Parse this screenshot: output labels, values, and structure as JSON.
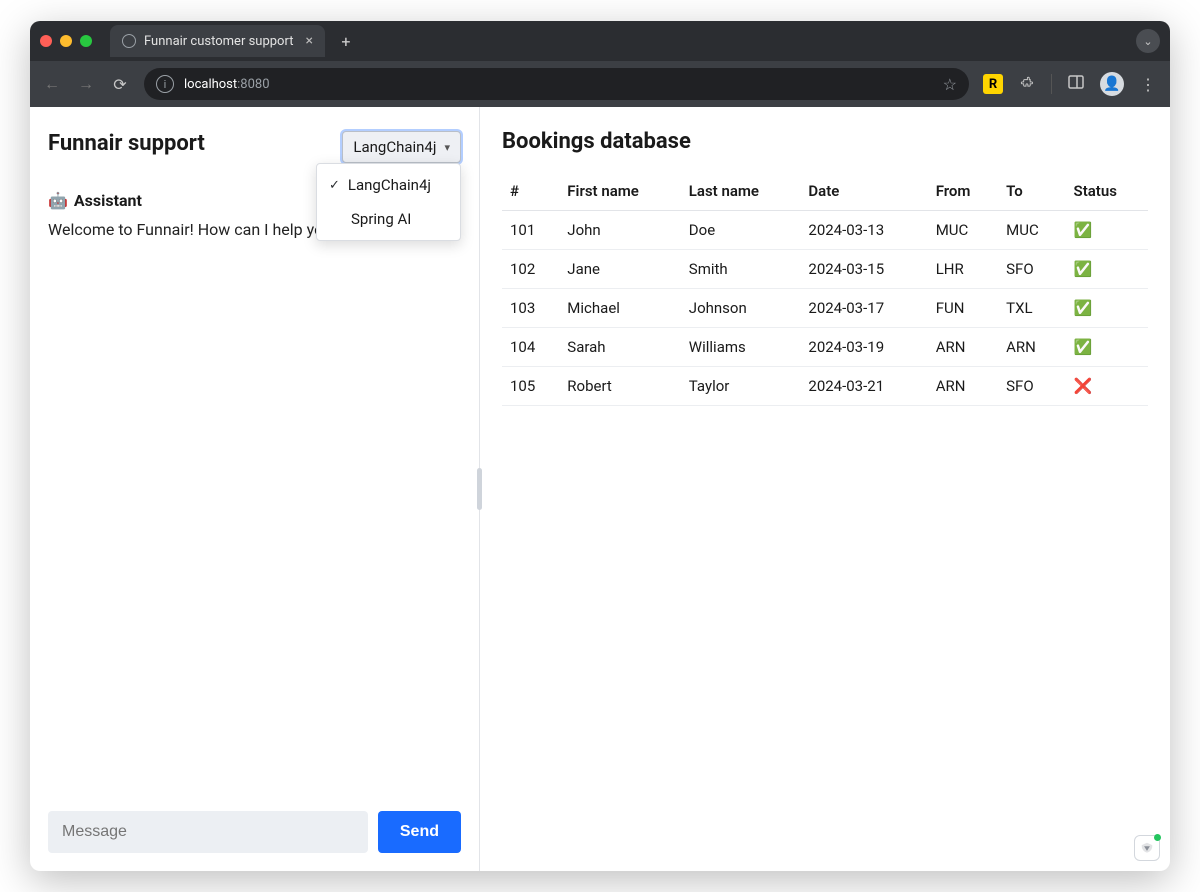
{
  "browser": {
    "tab_title": "Funnair customer support",
    "url_host": "localhost",
    "url_port": ":8080"
  },
  "left": {
    "title": "Funnair support",
    "model_selector": {
      "selected": "LangChain4j",
      "options": [
        "LangChain4j",
        "Spring AI"
      ]
    },
    "assistant_label": "Assistant",
    "assistant_message": "Welcome to Funnair! How can I help you?",
    "message_placeholder": "Message",
    "send_label": "Send"
  },
  "right": {
    "title": "Bookings database",
    "columns": [
      "#",
      "First name",
      "Last name",
      "Date",
      "From",
      "To",
      "Status"
    ],
    "rows": [
      {
        "id": "101",
        "first": "John",
        "last": "Doe",
        "date": "2024-03-13",
        "from": "MUC",
        "to": "MUC",
        "status": "✅"
      },
      {
        "id": "102",
        "first": "Jane",
        "last": "Smith",
        "date": "2024-03-15",
        "from": "LHR",
        "to": "SFO",
        "status": "✅"
      },
      {
        "id": "103",
        "first": "Michael",
        "last": "Johnson",
        "date": "2024-03-17",
        "from": "FUN",
        "to": "TXL",
        "status": "✅"
      },
      {
        "id": "104",
        "first": "Sarah",
        "last": "Williams",
        "date": "2024-03-19",
        "from": "ARN",
        "to": "ARN",
        "status": "✅"
      },
      {
        "id": "105",
        "first": "Robert",
        "last": "Taylor",
        "date": "2024-03-21",
        "from": "ARN",
        "to": "SFO",
        "status": "❌"
      }
    ]
  }
}
